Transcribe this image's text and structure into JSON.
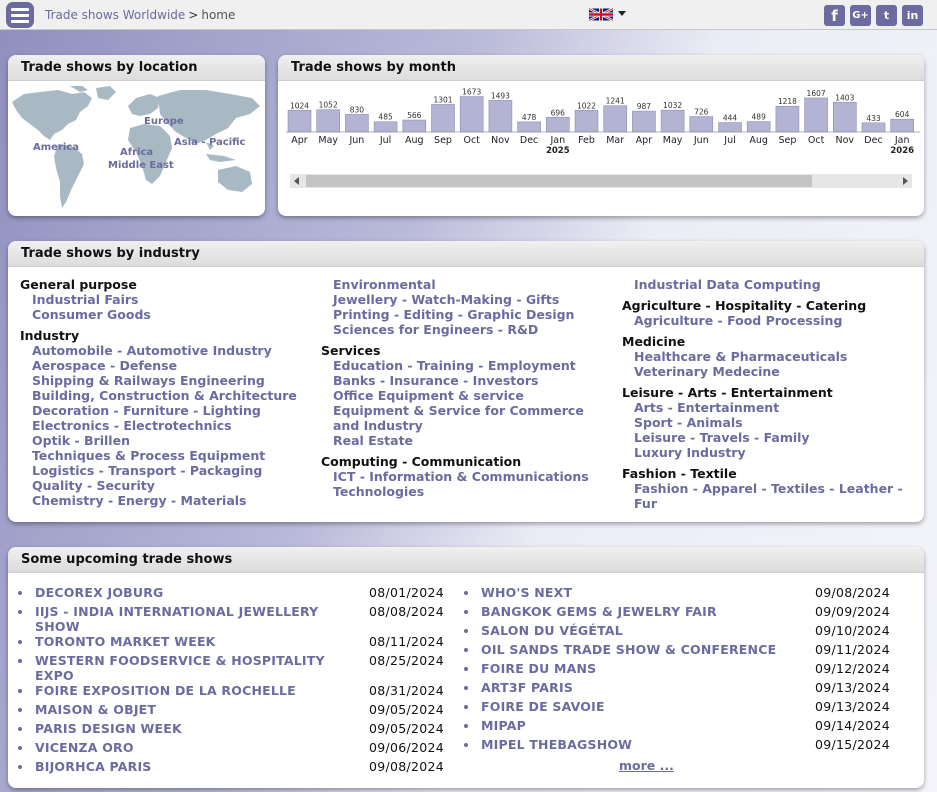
{
  "header": {
    "breadcrumb_root": "Trade shows Worldwide",
    "breadcrumb_sep": ">",
    "breadcrumb_current": "home",
    "social": {
      "facebook": "f",
      "google": "G+",
      "twitter": "t",
      "linkedin": "in"
    }
  },
  "location": {
    "title": "Trade shows by location",
    "regions": [
      "Europe",
      "America",
      "Asia - Pacific",
      "Africa",
      "Middle East"
    ]
  },
  "month": {
    "title": "Trade shows by month"
  },
  "chart_data": {
    "type": "bar",
    "title": "Trade shows by month",
    "categories": [
      "Apr",
      "May",
      "Jun",
      "Jul",
      "Aug",
      "Sep",
      "Oct",
      "Nov",
      "Dec",
      "Jan",
      "Feb",
      "Mar",
      "Apr",
      "May",
      "Jun",
      "Jul",
      "Aug",
      "Sep",
      "Oct",
      "Nov",
      "Dec",
      "Jan"
    ],
    "values": [
      1024,
      1052,
      830,
      485,
      566,
      1301,
      1673,
      1493,
      478,
      696,
      1022,
      1241,
      987,
      1032,
      726,
      444,
      489,
      1218,
      1607,
      1403,
      433,
      604
    ],
    "year_markers": [
      {
        "index": 9,
        "label": "2025"
      },
      {
        "index": 21,
        "label": "2026"
      }
    ],
    "bar_color": "#b3b3d3"
  },
  "industry": {
    "title": "Trade shows by industry",
    "columns": [
      [
        {
          "group": "General purpose",
          "items": [
            "Industrial Fairs",
            "Consumer Goods"
          ]
        },
        {
          "group": "Industry",
          "items": [
            "Automobile - Automotive Industry",
            "Aerospace - Defense",
            "Shipping & Railways Engineering",
            "Building, Construction & Architecture",
            "Decoration - Furniture - Lighting",
            "Electronics - Electrotechnics",
            "Optik - Brillen",
            "Techniques & Process Equipment",
            "Logistics - Transport - Packaging",
            "Quality - Security",
            "Chemistry - Energy - Materials"
          ]
        }
      ],
      [
        {
          "group": "",
          "items": [
            "Environmental",
            "Jewellery - Watch-Making - Gifts",
            "Printing - Editing - Graphic Design",
            "Sciences for Engineers - R&D"
          ]
        },
        {
          "group": "Services",
          "items": [
            "Education - Training - Employment",
            "Banks - Insurance - Investors",
            "Office Equipment & service",
            "Equipment & Service for Commerce and Industry",
            "Real Estate"
          ]
        },
        {
          "group": "Computing - Communication",
          "items": [
            "ICT - Information & Communications Technologies"
          ]
        }
      ],
      [
        {
          "group": "",
          "items": [
            "Industrial Data Computing"
          ]
        },
        {
          "group": "Agriculture - Hospitality - Catering",
          "items": [
            "Agriculture - Food Processing"
          ]
        },
        {
          "group": "Medicine",
          "items": [
            "Healthcare & Pharmaceuticals",
            "Veterinary Medecine"
          ]
        },
        {
          "group": "Leisure - Arts - Entertainment",
          "items": [
            "Arts - Entertainment",
            "Sport - Animals",
            "Leisure - Travels - Family",
            "Luxury Industry"
          ]
        },
        {
          "group": "Fashion - Textile",
          "items": [
            "Fashion - Apparel - Textiles - Leather - Fur"
          ]
        }
      ]
    ]
  },
  "upcoming": {
    "title": "Some upcoming trade shows",
    "left": [
      {
        "name": "DECOREX JOBURG",
        "date": "08/01/2024"
      },
      {
        "name": "IIJS - INDIA INTERNATIONAL JEWELLERY SHOW",
        "date": "08/08/2024"
      },
      {
        "name": "TORONTO MARKET WEEK",
        "date": "08/11/2024"
      },
      {
        "name": "WESTERN FOODSERVICE & HOSPITALITY EXPO",
        "date": "08/25/2024"
      },
      {
        "name": "FOIRE EXPOSITION DE LA ROCHELLE",
        "date": "08/31/2024"
      },
      {
        "name": "MAISON & OBJET",
        "date": "09/05/2024"
      },
      {
        "name": "PARIS DESIGN WEEK",
        "date": "09/05/2024"
      },
      {
        "name": "VICENZA ORO",
        "date": "09/06/2024"
      },
      {
        "name": "BIJORHCA PARIS",
        "date": "09/08/2024"
      }
    ],
    "right": [
      {
        "name": "WHO'S NEXT",
        "date": "09/08/2024"
      },
      {
        "name": "BANGKOK GEMS & JEWELRY FAIR",
        "date": "09/09/2024"
      },
      {
        "name": "SALON DU VÉGÉTAL",
        "date": "09/10/2024"
      },
      {
        "name": "OIL SANDS TRADE SHOW & CONFERENCE",
        "date": "09/11/2024"
      },
      {
        "name": "FOIRE DU MANS",
        "date": "09/12/2024"
      },
      {
        "name": "ART3F PARIS",
        "date": "09/13/2024"
      },
      {
        "name": "FOIRE DE SAVOIE",
        "date": "09/13/2024"
      },
      {
        "name": "MIPAP",
        "date": "09/14/2024"
      },
      {
        "name": "MIPEL THEBAGSHOW",
        "date": "09/15/2024"
      }
    ],
    "more_label": "more ..."
  },
  "colors": {
    "accent": "#6b6ba0",
    "bar": "#b3b3d3",
    "map": "#a9b9c3"
  }
}
